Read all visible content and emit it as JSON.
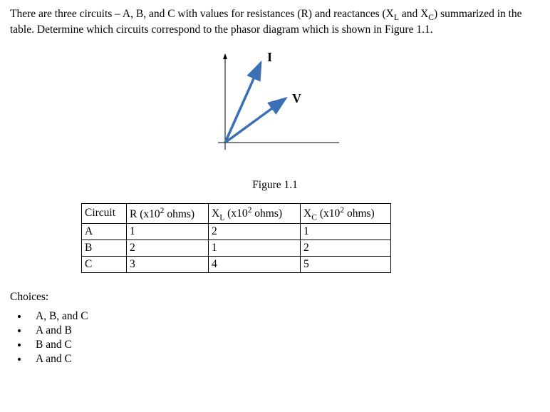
{
  "question": {
    "pre": "There are three circuits – A, B, and C with values for resistances (R) and reactances (X",
    "sub1": "L",
    "mid1": " and X",
    "sub2": "C",
    "post": ") summarized in the table. Determine which circuits correspond to the phasor diagram which is shown in Figure 1.1."
  },
  "figure": {
    "label_I": "I",
    "label_V": "V",
    "caption": "Figure 1.1"
  },
  "table": {
    "headers": {
      "circuit": "Circuit",
      "r_pre": "R (x10",
      "r_sup": "2",
      "r_post": " ohms)",
      "xl_pre": "X",
      "xl_sub": "L",
      "xl_mid": " (x10",
      "xl_sup": "2",
      "xl_post": " ohms)",
      "xc_pre": "X",
      "xc_sub": "C",
      "xc_mid": " (x10",
      "xc_sup": "2",
      "xc_post": " ohms)"
    },
    "rows": [
      {
        "circuit": "A",
        "r": "1",
        "xl": "2",
        "xc": "1"
      },
      {
        "circuit": "B",
        "r": "2",
        "xl": "1",
        "xc": "2"
      },
      {
        "circuit": "C",
        "r": "3",
        "xl": "4",
        "xc": "5"
      }
    ]
  },
  "choices": {
    "label": "Choices:",
    "items": [
      "A, B, and C",
      "A and B",
      "B and C",
      "A and C"
    ]
  },
  "chart_data": {
    "type": "table",
    "title": "Circuit resistance and reactance values (×10² ohms)",
    "columns": [
      "Circuit",
      "R (×10² Ω)",
      "X_L (×10² Ω)",
      "X_C (×10² Ω)"
    ],
    "rows": [
      [
        "A",
        1,
        2,
        1
      ],
      [
        "B",
        2,
        1,
        2
      ],
      [
        "C",
        3,
        4,
        5
      ]
    ]
  }
}
